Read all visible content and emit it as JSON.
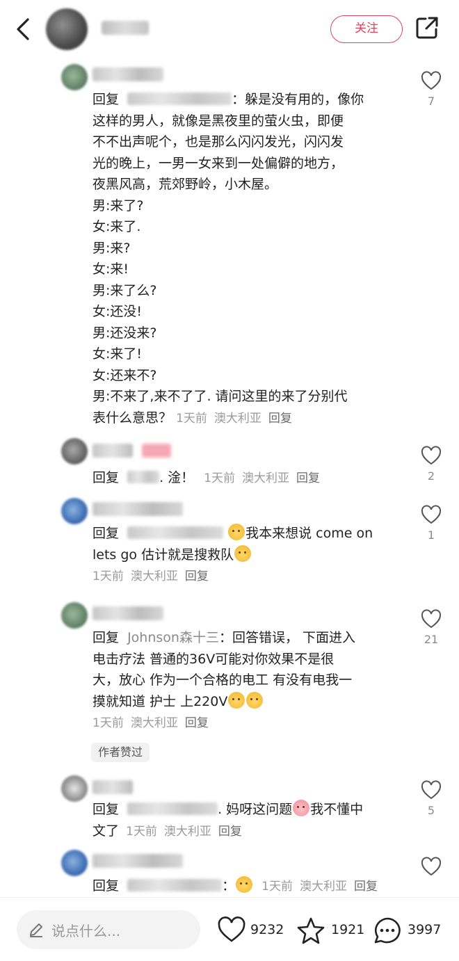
{
  "header": {
    "follow_label": "关注",
    "icons": {
      "back": "back-chevron-icon",
      "share": "share-icon"
    }
  },
  "comments": [
    {
      "reply_prefix": "回复",
      "text_lines": [
        "：躲是没有用的，像你",
        "这样的男人，就像是黑夜里的萤火虫，即便",
        "不不出声呢个，也是那么闪闪发光，闪闪发",
        "光的晚上，一男一女来到一处偏僻的地方，",
        "夜黑风高，荒郊野岭，小木屋。",
        "男:来了?",
        "女:来了.",
        "男:来?",
        "女:来!",
        "男:来了么?",
        "女:还没!",
        "男:还没来?",
        "女:来了!",
        "女:还来不?",
        "男:不来了,来不了了. 请问这里的来了分别代",
        "表什么意思？"
      ],
      "time": "1天前",
      "location": "澳大利亚",
      "reply": "回复",
      "likes": "7"
    },
    {
      "reply_prefix": "回复",
      "text": ".  淦！",
      "time": "1天前",
      "location": "澳大利亚",
      "reply": "回复",
      "likes": "2"
    },
    {
      "reply_prefix": "回复",
      "line1": "我本来想说 come on",
      "line2": "lets go 估计就是搜救队",
      "time": "1天前",
      "location": "澳大利亚",
      "reply": "回复",
      "likes": "1"
    },
    {
      "reply_prefix": "回复",
      "mention": "Johnson森十三",
      "line1": "：回答错误， 下面进入",
      "line2": "电击疗法 普通的36V可能对你效果不是很",
      "line3": "大，放心 作为一个合格的电工 有没有电我一",
      "line4": "摸就知道 护士 上220V",
      "time": "1天前",
      "location": "澳大利亚",
      "reply": "回复",
      "author_liked": "作者赞过",
      "likes": "21"
    },
    {
      "reply_prefix": "回复",
      "line1a": ". 妈呀这问题",
      "line1b": "我不懂中",
      "line2": "文了",
      "time": "1天前",
      "location": "澳大利亚",
      "reply": "回复",
      "likes": "5"
    },
    {
      "reply_prefix": "回复",
      "text": "：",
      "time": "1天前",
      "location": "澳大利亚",
      "reply": "回复",
      "likes": ""
    }
  ],
  "bottom": {
    "input_placeholder": "说点什么...",
    "likes": "9232",
    "favorites": "1921",
    "comments": "3997",
    "icons": {
      "input": "pencil-icon",
      "like": "heart-icon",
      "favorite": "star-icon",
      "comment": "comment-bubble-icon"
    }
  },
  "colors": {
    "accent": "#e0415c",
    "meta_grey": "#9a9a9a"
  }
}
